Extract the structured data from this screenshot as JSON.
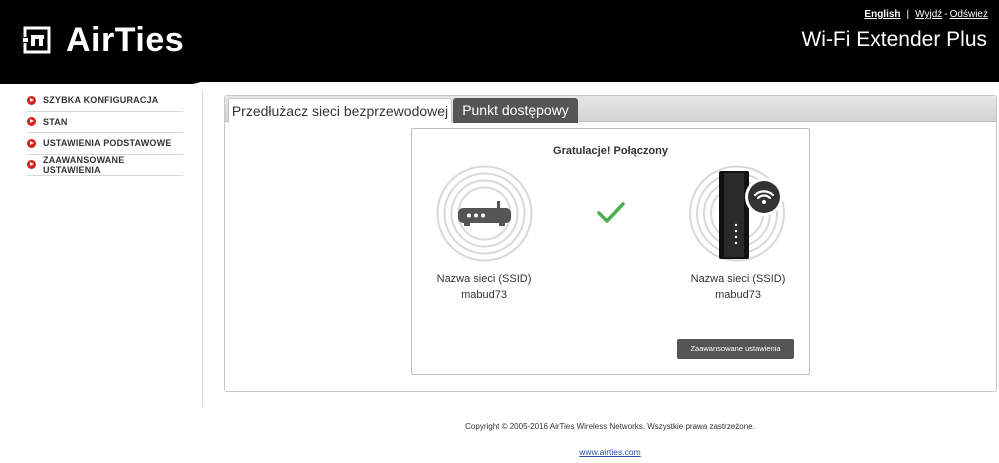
{
  "header": {
    "logo_text": "AirTies",
    "product_title": "Wi-Fi Extender Plus",
    "links": {
      "language": "English",
      "separator": "|",
      "logout": "Wyjdź",
      "dash": "-",
      "refresh": "Odśwież"
    }
  },
  "sidebar": {
    "items": [
      {
        "label": "SZYBKA KONFIGURACJA"
      },
      {
        "label": "STAN"
      },
      {
        "label": "USTAWIENIA PODSTAWOWE"
      },
      {
        "label": "ZAAWANSOWANE USTAWIENIA"
      }
    ]
  },
  "tabs": [
    {
      "label": "Przedłużacz sieci bezprzewodowej",
      "active": true
    },
    {
      "label": "Punkt dostępowy",
      "active": false
    }
  ],
  "status": {
    "title": "Gratulacje! Połączony",
    "left_device": {
      "ssid_label": "Nazwa sieci (SSID)",
      "ssid_value": "mabud73",
      "icon": "router-icon"
    },
    "right_device": {
      "ssid_label": "Nazwa sieci (SSID)",
      "ssid_value": "mabud73",
      "icon": "extender-icon"
    },
    "check_icon": "checkmark-icon",
    "advanced_button": "Zaawansowane ustawienia"
  },
  "footer": {
    "copyright": "Copyright © 2005-2016 AirTies Wireless Networks. Wszystkie prawa zastrzeżone.",
    "website": "www.airties.com"
  },
  "colors": {
    "header_bg": "#000000",
    "accent_red": "#d6201f",
    "check_green": "#4caf50",
    "button_dark": "#555555"
  }
}
